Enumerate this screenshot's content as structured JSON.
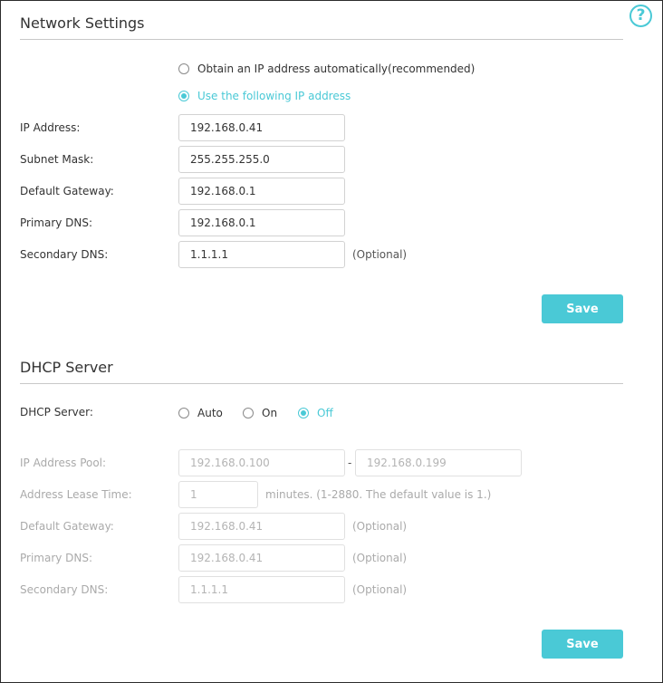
{
  "help": {
    "glyph": "?"
  },
  "network": {
    "title": "Network Settings",
    "mode_options": [
      "Obtain an IP address automatically(recommended)",
      "Use the following IP address"
    ],
    "selected_mode": 1,
    "fields": {
      "ip_label": "IP Address:",
      "ip_value": "192.168.0.41",
      "subnet_label": "Subnet Mask:",
      "subnet_value": "255.255.255.0",
      "gateway_label": "Default Gateway:",
      "gateway_value": "192.168.0.1",
      "dns1_label": "Primary DNS:",
      "dns1_value": "192.168.0.1",
      "dns2_label": "Secondary DNS:",
      "dns2_value": "1.1.1.1",
      "dns2_hint": "(Optional)"
    },
    "save_label": "Save"
  },
  "dhcp": {
    "title": "DHCP Server",
    "server_label": "DHCP Server:",
    "options": [
      "Auto",
      "On",
      "Off"
    ],
    "selected": 2,
    "pool_label": "IP Address Pool:",
    "pool_start": "192.168.0.100",
    "pool_sep": "-",
    "pool_end": "192.168.0.199",
    "lease_label": "Address Lease Time:",
    "lease_value": "1",
    "lease_hint": "minutes. (1-2880. The default value is 1.)",
    "gateway_label": "Default Gateway:",
    "gateway_value": "192.168.0.41",
    "gateway_hint": "(Optional)",
    "dns1_label": "Primary DNS:",
    "dns1_value": "192.168.0.41",
    "dns1_hint": "(Optional)",
    "dns2_label": "Secondary DNS:",
    "dns2_value": "1.1.1.1",
    "dns2_hint": "(Optional)",
    "save_label": "Save"
  },
  "colors": {
    "accent": "#4ac9d6",
    "text": "#333333",
    "disabled_text": "#aaaaaa",
    "rule": "#c8c8c8"
  }
}
